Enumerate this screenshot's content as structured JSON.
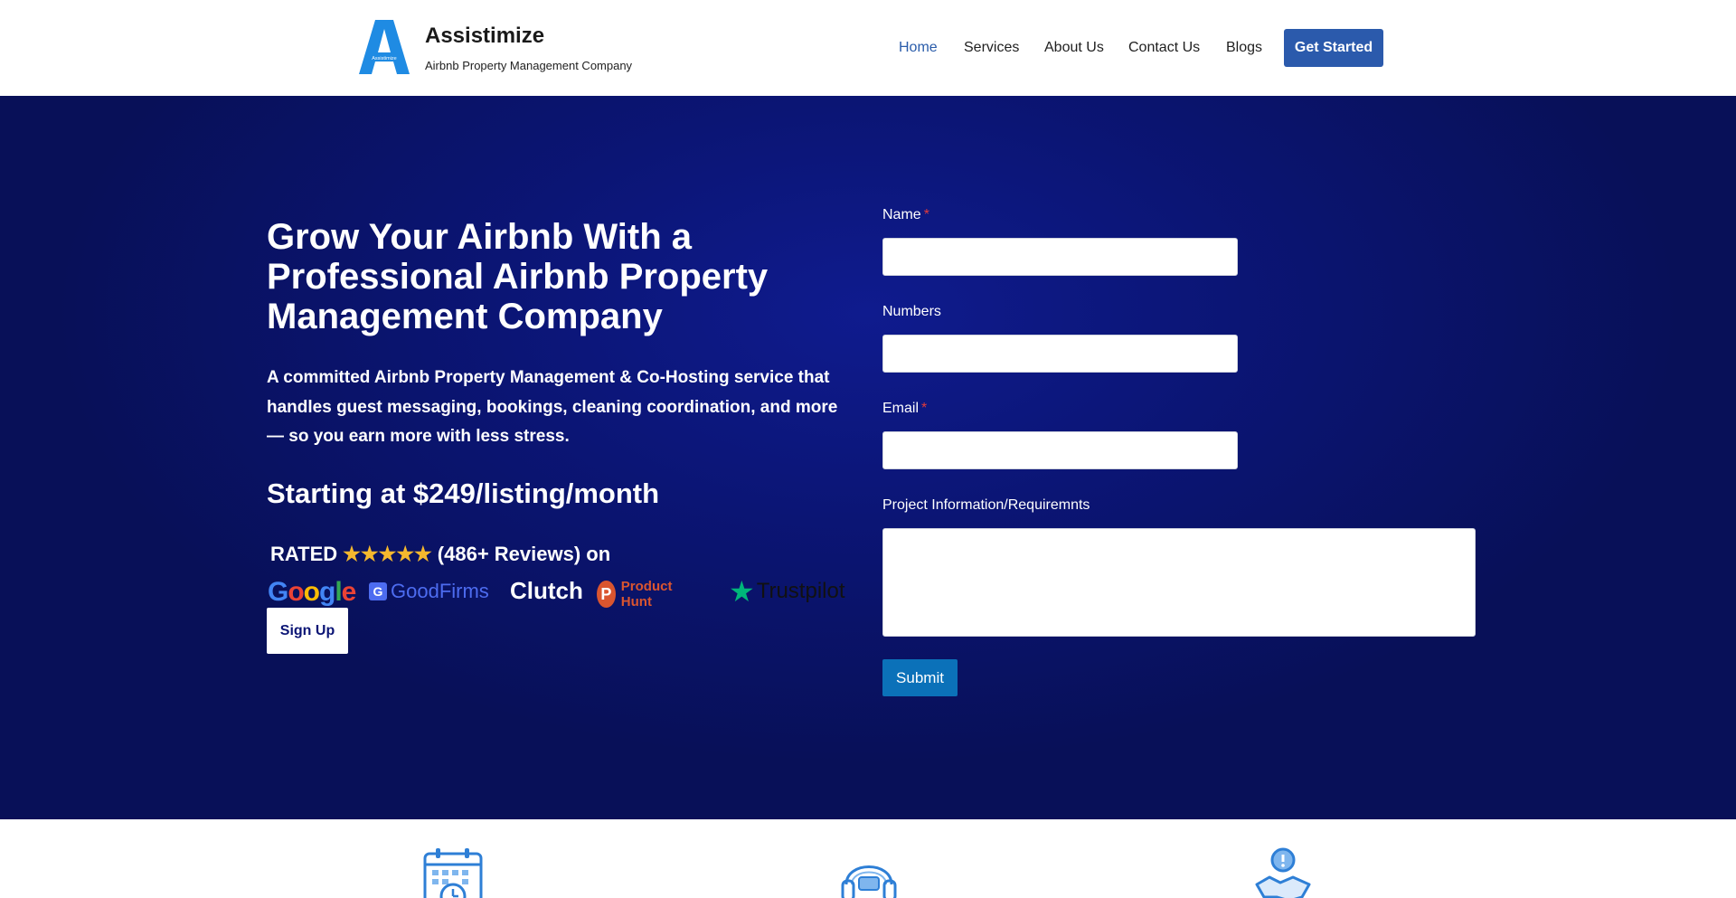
{
  "header": {
    "brand_name": "Assistimize",
    "brand_tagline": "Airbnb Property Management Company",
    "logo_letter": "A",
    "logo_small_text": "Assistimize",
    "nav": [
      {
        "label": "Home",
        "active": true
      },
      {
        "label": "Services",
        "active": false
      },
      {
        "label": "About Us",
        "active": false
      },
      {
        "label": "Contact Us",
        "active": false
      },
      {
        "label": "Blogs",
        "active": false
      }
    ],
    "cta_label": "Get Started"
  },
  "hero": {
    "title": "Grow Your Airbnb With a Professional Airbnb Property Management Company",
    "description": "A committed Airbnb Property Management & Co-Hosting service that handles guest messaging, bookings, cleaning coordination, and more — so you earn more with less stress.",
    "price": "Starting at $249/listing/month",
    "rated_prefix": "RATED",
    "stars": "★★★★★",
    "rated_suffix": "(486+ Reviews) on",
    "review_platforms": {
      "google": "Google",
      "goodfirms": "GoodFirms",
      "clutch": "Clutch",
      "producthunt": "Product Hunt",
      "producthunt_letter": "P",
      "trustpilot": "Trustpilot"
    },
    "signup_label": "Sign Up"
  },
  "form": {
    "name_label": "Name",
    "numbers_label": "Numbers",
    "email_label": "Email",
    "required_mark": "*",
    "project_label": "Project Information/Requiremnts",
    "name_value": "",
    "numbers_value": "",
    "email_value": "",
    "project_value": "",
    "submit_label": "Submit"
  },
  "features": {
    "icons": [
      "calendar-clock-icon",
      "headset-icon",
      "handshake-icon"
    ]
  },
  "colors": {
    "brand_blue": "#2b5aac",
    "nav_active": "#2a5caa",
    "hero_bg": "#0b1575",
    "submit_blue": "#0b71b9",
    "star_gold": "#f5b82e",
    "required_red": "#e23b3b",
    "icon_blue": "#2e7fd6"
  }
}
